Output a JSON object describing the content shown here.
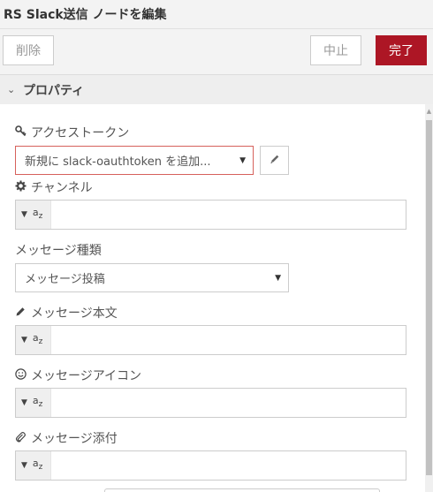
{
  "header": {
    "title": "RS Slack送信 ノードを編集"
  },
  "toolbar": {
    "delete_label": "削除",
    "cancel_label": "中止",
    "done_label": "完了"
  },
  "section": {
    "title": "プロパティ",
    "chevron_icon": "chevron-down-icon"
  },
  "fields": {
    "access_token": {
      "label": "アクセストークン",
      "icon": "key-icon",
      "value": "新規に slack-oauthtoken を追加...",
      "edit_icon": "pencil-icon"
    },
    "channel": {
      "label": "チャンネル",
      "icon": "cog-icon",
      "type": "az",
      "value": ""
    },
    "message_type": {
      "label": "メッセージ種類",
      "value": "メッセージ投稿"
    },
    "message_body": {
      "label": "メッセージ本文",
      "icon": "pencil-icon",
      "type": "az",
      "value": ""
    },
    "message_icon": {
      "label": "メッセージアイコン",
      "icon": "smile-icon",
      "type": "az",
      "value": ""
    },
    "message_attach": {
      "label": "メッセージ添付",
      "icon": "paperclip-icon",
      "type": "az",
      "value": ""
    }
  },
  "colors": {
    "accent": "#ad1625",
    "error_border": "#d6615c"
  }
}
